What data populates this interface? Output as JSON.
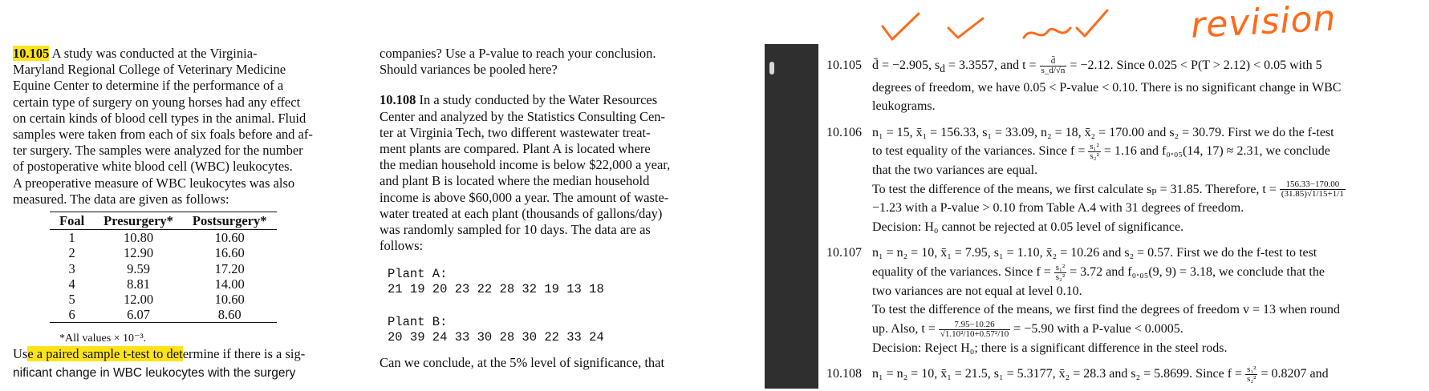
{
  "left_page": {
    "p105": {
      "number": "10.105",
      "lines": [
        "A study was conducted at the Virginia-",
        "Maryland Regional College of Veterinary Medicine",
        "Equine Center to determine if the performance of a",
        "certain type of surgery on young horses had any effect",
        "on certain kinds of blood cell types in the animal. Fluid",
        "samples were taken from each of six foals before and af-",
        "ter surgery. The samples were analyzed for the number",
        "of postoperative white blood cell (WBC) leukocytes.",
        "A preoperative measure of WBC leukocytes was also",
        "measured. The data are given as follows:"
      ],
      "table": {
        "headers": [
          "Foal",
          "Presurgery*",
          "Postsurgery*"
        ],
        "rows": [
          [
            "1",
            "10.80",
            "10.60"
          ],
          [
            "2",
            "12.90",
            "16.60"
          ],
          [
            "3",
            "9.59",
            "17.20"
          ],
          [
            "4",
            "8.81",
            "14.00"
          ],
          [
            "5",
            "12.00",
            "10.60"
          ],
          [
            "6",
            "6.07",
            "8.60"
          ]
        ]
      },
      "footnote": "*All values × 10⁻³.",
      "question_pre": "Us",
      "question_hl": "e a paired sample t-test to det",
      "question_post": "ermine if there is a sig-",
      "question_line2": "nificant change in WBC leukocytes with the surgery"
    },
    "col2": {
      "cont_lines": [
        "companies? Use a P-value to reach your conclusion.",
        "Should variances be pooled here?"
      ],
      "p108_number": "10.108",
      "p108_lines": [
        "In a study conducted by the Water Resources",
        "Center and analyzed by the Statistics Consulting Cen-",
        "ter at Virginia Tech, two different wastewater treat-",
        "ment plants are compared. Plant A is located where",
        "the median household income is below $22,000 a year,",
        "and plant B is located where the median household",
        "income is above $60,000 a year. The amount of waste-",
        "water treated at each plant (thousands of gallons/day)",
        "was randomly sampled for 10 days. The data are as",
        "follows:"
      ],
      "plant_a_label": "Plant A:",
      "plant_a_values": "21 19 20 23 22 28 32 19 13 18",
      "plant_b_label": "Plant B:",
      "plant_b_values": "20 39 24 33 30 28 30 22 33 24",
      "last_line": "Can we conclude, at the 5% level of significance, that"
    }
  },
  "right_page": {
    "handwriting": "revision",
    "s105": {
      "num": "10.105",
      "l1a": "d̄ = −2.905, s",
      "l1b": " = 3.3557, and t = ",
      "l1c": " = −2.12. Since 0.025 < P(T > 2.12) < 0.05 with 5",
      "frac_n": "d̄",
      "frac_d": "s_d/√n",
      "l2": "degrees of freedom, we have 0.05 < P-value < 0.10. There is no significant change in WBC",
      "l3": "leukograms."
    },
    "s106": {
      "num": "10.106",
      "l1": "n₁ = 15, x̄₁ = 156.33, s₁ = 33.09, n₂ = 18, x̄₂ = 170.00 and s₂ = 30.79. First we do the f-test",
      "l2a": "to test equality of the variances. Since f = ",
      "l2b": " = 1.16 and f₀.₀₅(14, 17) ≈ 2.31, we conclude",
      "l3": "that the two variances are equal.",
      "l4a": "To test the difference of the means, we first calculate sₚ = 31.85. Therefore, t = ",
      "frac_n": "156.33−170.00",
      "frac_d": "(31.85)√1/15+1/1",
      "l5": "−1.23 with a P-value > 0.10 from Table A.4 with 31 degrees of freedom.",
      "l6": "Decision: H₀ cannot be rejected at 0.05 level of significance."
    },
    "s107": {
      "num": "10.107",
      "l1": "n₁ = n₂ = 10, x̄₁ = 7.95, s₁ = 1.10, x̄₂ = 10.26 and s₂ = 0.57. First we do the f-test to test",
      "l2a": "equality of the variances. Since f = ",
      "l2b": " = 3.72 and f₀.₀₅(9, 9) = 3.18, we conclude that the",
      "l3": "two variances are not equal at level 0.10.",
      "l4": "To test the difference of the means, we first find the degrees of freedom v = 13 when round",
      "l5a": "up. Also, t = ",
      "frac_n": "7.95−10.26",
      "frac_d": "√1.10²/10+0.57²/10",
      "l5b": " = −5.90 with a P-value < 0.0005.",
      "l6": "Decision: Reject H₀; there is a significant difference in the steel rods."
    },
    "s108": {
      "num": "10.108",
      "l1a": "n₁ = n₂ = 10, x̄₁ = 21.5, s₁ = 5.3177, x̄₂ = 28.3 and s₂ = 5.8699. Since f = ",
      "l1b": " = 0.8207 and"
    },
    "f_frac_n": "s₁²",
    "f_frac_d": "s₂²",
    "sd_sub": "d"
  },
  "colors": {
    "highlight": "#ffe31a",
    "ink": "#ff6a1a",
    "separator": "#2f2f2f"
  }
}
